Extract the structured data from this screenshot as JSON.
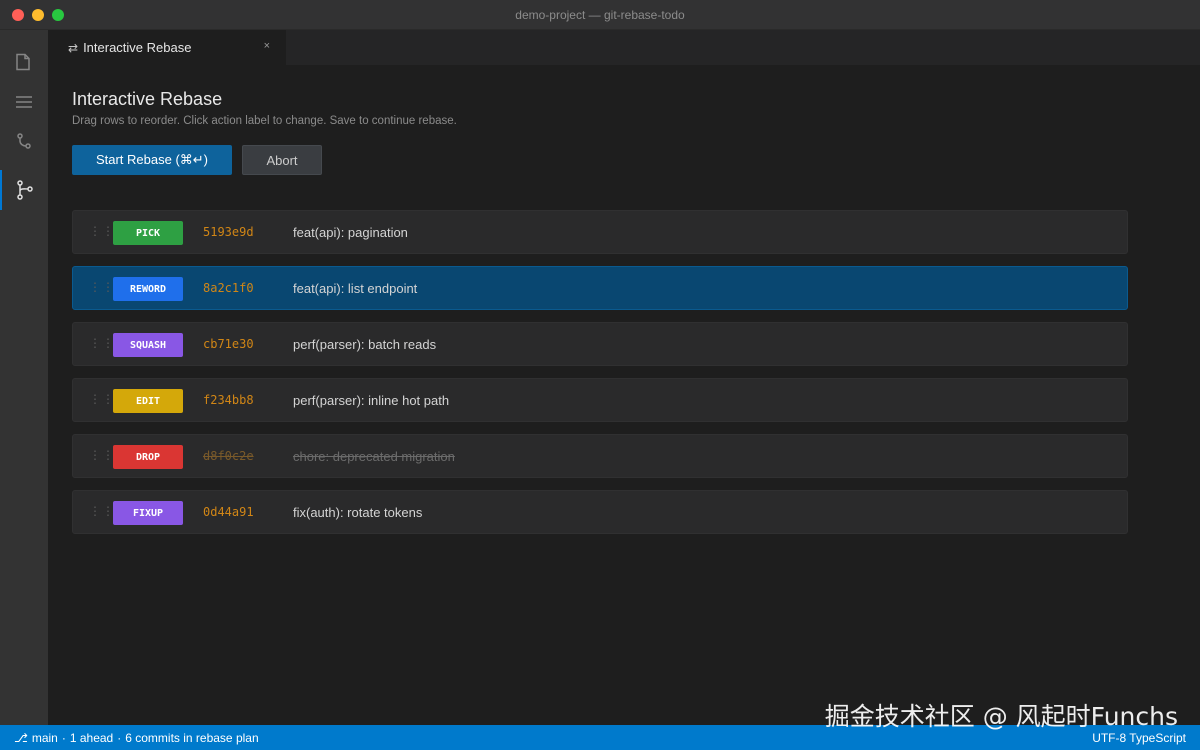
{
  "window": {
    "title": "demo-project — git-rebase-todo"
  },
  "activitybar": {
    "items": [
      {
        "icon": "files-icon"
      },
      {
        "icon": "list-icon"
      },
      {
        "icon": "source-control-icon"
      },
      {
        "icon": "git-graph-icon",
        "active": true
      }
    ]
  },
  "tab": {
    "icon": "⇄",
    "label": "Interactive Rebase",
    "close": "×"
  },
  "page": {
    "title": "Interactive Rebase",
    "subtitle": "Drag rows to reorder. Click action label to change. Save to continue rebase."
  },
  "buttons": {
    "start": "Start Rebase (⌘↵)",
    "abort": "Abort"
  },
  "rows": [
    {
      "handle": "⋮⋮",
      "action": "PICK",
      "color": "#2ea043",
      "sha": "5193e9d",
      "message": "feat(api): pagination"
    },
    {
      "handle": "⋮⋮",
      "action": "REWORD",
      "color": "#1f6feb",
      "sha": "8a2c1f0",
      "message": "feat(api): list endpoint"
    },
    {
      "handle": "⋮⋮",
      "action": "SQUASH",
      "color": "#8957e5",
      "sha": "cb71e30",
      "message": "perf(parser): batch reads"
    },
    {
      "handle": "⋮⋮",
      "action": "EDIT",
      "color": "#d4a80a",
      "sha": "f234bb8",
      "message": "perf(parser): inline hot path"
    },
    {
      "handle": "⋮⋮",
      "action": "DROP",
      "color": "#da3633",
      "sha": "d8f0c2e",
      "message": "chore: deprecated migration"
    },
    {
      "handle": "⋮⋮",
      "action": "FIXUP",
      "color": "#8957e5",
      "sha": "0d44a91",
      "message": "fix(auth): rotate tokens"
    }
  ],
  "statusbar": {
    "branch_icon": "⎇",
    "branch": "main",
    "sep1": "·",
    "ahead": "1 ahead",
    "sep2": "·",
    "plan": "6 commits in rebase plan",
    "right": "UTF-8 TypeScript"
  },
  "watermark": "掘金技术社区 @ 风起时Funchs",
  "colors": {
    "accent": "#007acc",
    "primary_button": "#0e639c",
    "selected_row": "#094771",
    "sha": "#d18616"
  }
}
